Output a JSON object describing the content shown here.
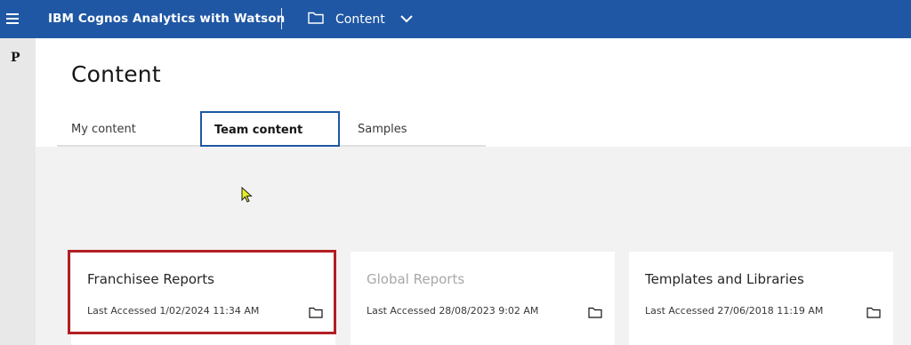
{
  "app": {
    "title": "IBM Cognos Analytics with Watson"
  },
  "topbar": {
    "menu_label": "Content",
    "icons": [
      "hamburger-menu-icon",
      "folder-icon",
      "chevron-down-icon"
    ]
  },
  "leftrail": {
    "icon_glyph": "P"
  },
  "page": {
    "title": "Content"
  },
  "tabs": [
    {
      "label": "My content",
      "selected": false
    },
    {
      "label": "Team content",
      "selected": true
    },
    {
      "label": "Samples",
      "selected": false
    }
  ],
  "cards": [
    {
      "title": "Franchisee Reports",
      "meta": "Last Accessed 1/02/2024 11:34 AM",
      "icon": "folder-icon",
      "highlighted": true
    },
    {
      "title": "Global Reports",
      "meta": "Last Accessed 28/08/2023 9:02 AM",
      "icon": "folder-icon",
      "highlighted": false
    },
    {
      "title": "Templates and Libraries",
      "meta": "Last Accessed 27/06/2018 11:19 AM",
      "icon": "folder-icon",
      "highlighted": false
    }
  ],
  "colors": {
    "brand": "#1f57a4",
    "highlight": "#b21f24",
    "background": "#f2f2f2",
    "cursor": "#e5ee1e"
  }
}
